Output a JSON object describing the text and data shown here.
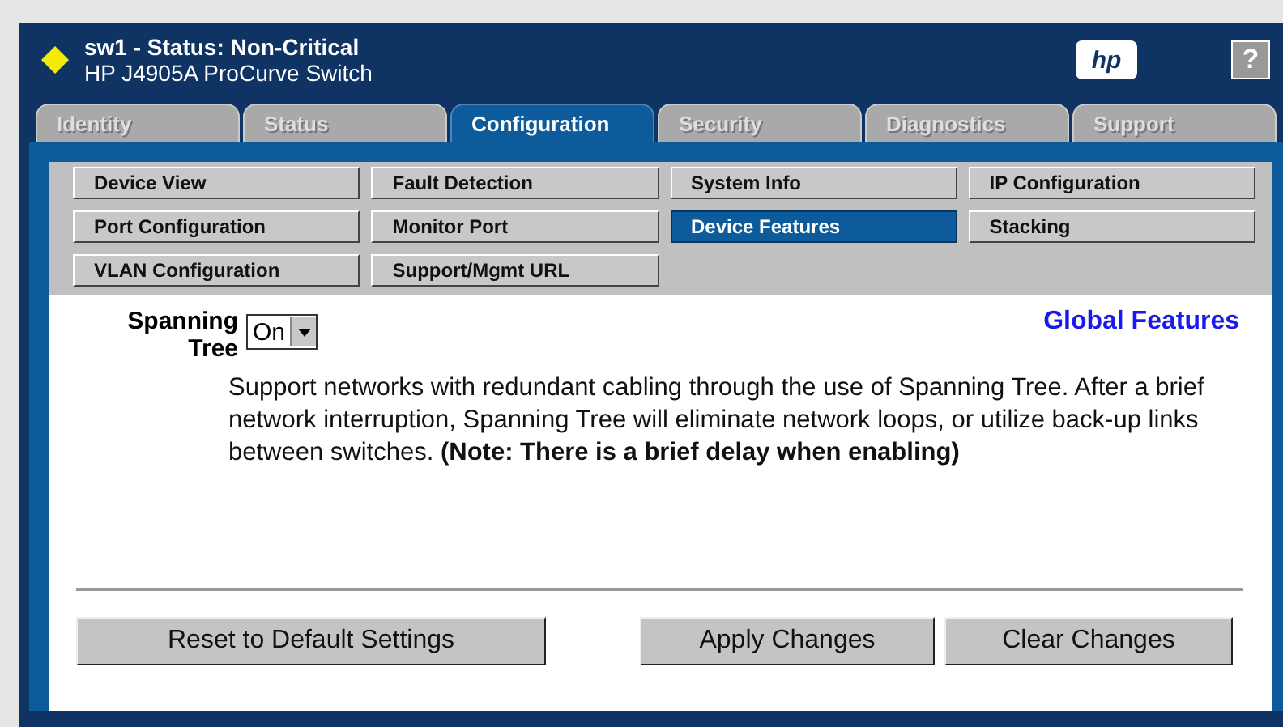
{
  "header": {
    "title": "sw1 - Status: Non-Critical",
    "subtitle": "HP J4905A ProCurve Switch",
    "logo": "hp",
    "help": "?"
  },
  "tabs": [
    {
      "label": "Identity",
      "selected": false
    },
    {
      "label": "Status",
      "selected": false
    },
    {
      "label": "Configuration",
      "selected": true
    },
    {
      "label": "Security",
      "selected": false
    },
    {
      "label": "Diagnostics",
      "selected": false
    },
    {
      "label": "Support",
      "selected": false
    }
  ],
  "subnav": [
    {
      "label": "Device View",
      "selected": false
    },
    {
      "label": "Fault Detection",
      "selected": false
    },
    {
      "label": "System Info",
      "selected": false
    },
    {
      "label": "IP Configuration",
      "selected": false
    },
    {
      "label": "Port Configuration",
      "selected": false
    },
    {
      "label": "Monitor Port",
      "selected": false
    },
    {
      "label": "Device Features",
      "selected": true
    },
    {
      "label": "Stacking",
      "selected": false
    },
    {
      "label": "VLAN Configuration",
      "selected": false
    },
    {
      "label": "Support/Mgmt URL",
      "selected": false
    }
  ],
  "setting": {
    "label": "Spanning Tree",
    "value": "On"
  },
  "global_features_link": "Global Features",
  "description": "Support networks with redundant cabling through the use of Spanning Tree. After a brief network interruption, Spanning Tree will eliminate network loops, or utilize back-up links between switches. **(Note: There is a brief delay when enabling)**",
  "buttons": [
    "Reset to Default Settings",
    "Apply Changes",
    "Clear Changes"
  ]
}
